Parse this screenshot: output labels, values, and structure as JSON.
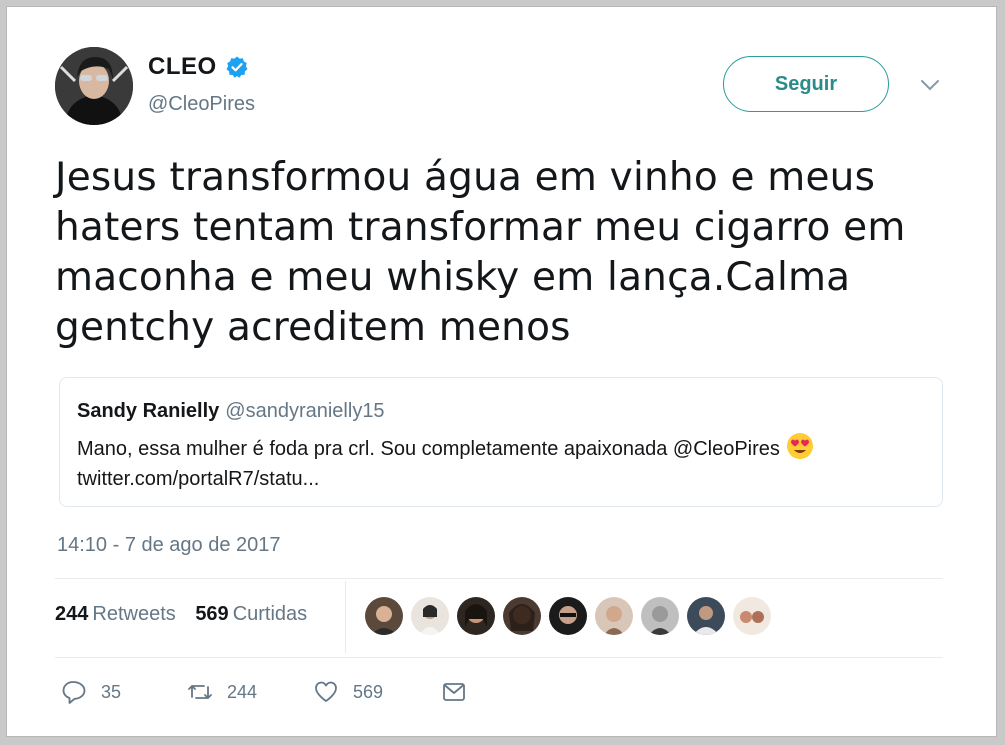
{
  "author": {
    "name": "CLEO",
    "handle": "@CleoPires",
    "verified": true
  },
  "header": {
    "follow_label": "Seguir"
  },
  "tweet": {
    "text": "Jesus transformou água em vinho e meus haters tentam transformar meu cigarro em maconha e meu whisky em lança.Calma gentchy acreditem menos",
    "timestamp": "14:10 - 7 de ago de 2017"
  },
  "quoted_tweet": {
    "name": "Sandy Ranielly",
    "handle": "@sandyranielly15",
    "text": "Mano, essa mulher é foda pra crl. Sou completamente apaixonada @CleoPires",
    "link": "twitter.com/portalR7/statu..."
  },
  "stats": {
    "retweets_count": "244",
    "retweets_label": "Retweets",
    "likes_count": "569",
    "likes_label": "Curtidas"
  },
  "actions": {
    "reply_count": "35",
    "retweet_count": "244",
    "like_count": "569"
  },
  "icons": [
    "verified-badge-icon",
    "chevron-down-icon",
    "heart-eyes-emoji-icon",
    "reply-icon",
    "retweet-icon",
    "heart-icon",
    "message-icon"
  ],
  "colors": {
    "accent": "#2a9c9a",
    "verified": "#1da1f2",
    "muted": "#657786",
    "text": "#14171a"
  }
}
